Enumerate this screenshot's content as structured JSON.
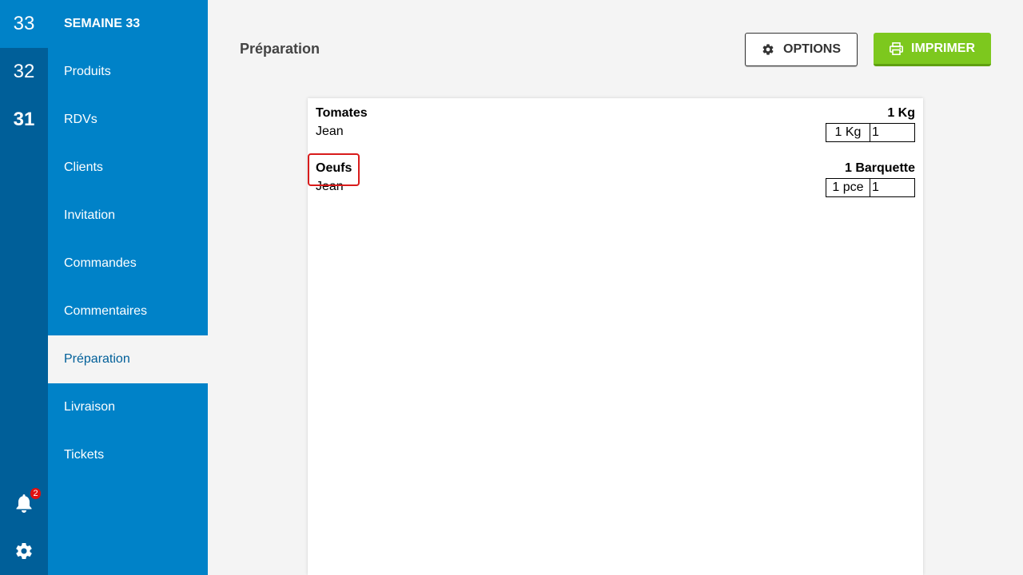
{
  "weeks": [
    {
      "label": "33"
    },
    {
      "label": "32"
    },
    {
      "label": "31"
    }
  ],
  "notifications": {
    "count": "2"
  },
  "nav": {
    "header": "SEMAINE 33",
    "items": [
      {
        "label": "Produits"
      },
      {
        "label": "RDVs"
      },
      {
        "label": "Clients"
      },
      {
        "label": "Invitation"
      },
      {
        "label": "Commandes"
      },
      {
        "label": "Commentaires"
      },
      {
        "label": "Préparation"
      },
      {
        "label": "Livraison"
      },
      {
        "label": "Tickets"
      }
    ],
    "selected": "Préparation"
  },
  "header": {
    "title": "Préparation",
    "options_label": "OPTIONS",
    "print_label": "IMPRIMER"
  },
  "colors": {
    "primary": "#0082c8",
    "rail": "#005f99",
    "print": "#7dc81e",
    "highlight": "#d81b1b"
  },
  "sheet": {
    "items": [
      {
        "name": "Tomates",
        "total": "1 Kg",
        "client": "Jean",
        "unit": "1 Kg",
        "value": "1"
      },
      {
        "name": "Oeufs",
        "total": "1 Barquette",
        "client": "Jean",
        "unit": "1 pce",
        "value": "1"
      }
    ]
  }
}
